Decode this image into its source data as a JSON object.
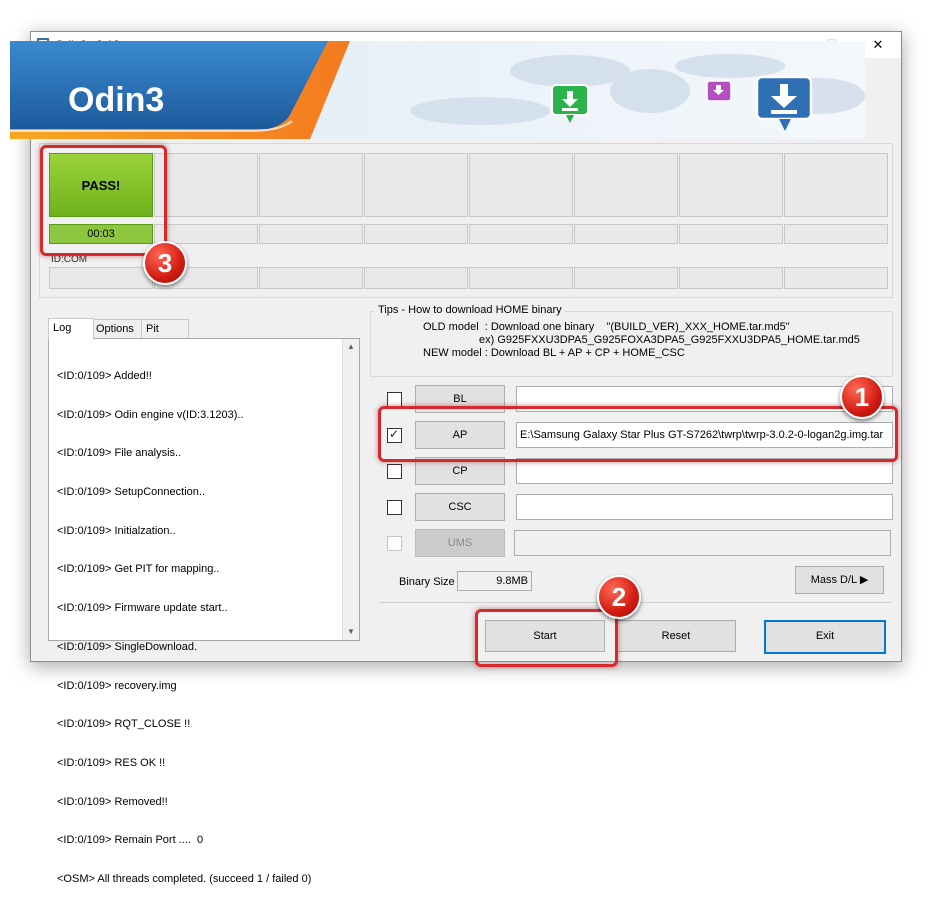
{
  "window": {
    "title": "Odin3 v3.12",
    "minimize_glyph": "—",
    "maximize_glyph": "☐",
    "close_glyph": "✕"
  },
  "banner": {
    "logo_text": "Odin3"
  },
  "ports": {
    "first_status": "PASS!",
    "first_time": "00:03",
    "id_com_label": "ID:COM"
  },
  "badges": {
    "one": "1",
    "two": "2",
    "three": "3"
  },
  "tabs": {
    "log": "Log",
    "options": "Options",
    "pit": "Pit"
  },
  "log": {
    "lines": [
      "<ID:0/109> Added!!",
      "<ID:0/109> Odin engine v(ID:3.1203)..",
      "<ID:0/109> File analysis..",
      "<ID:0/109> SetupConnection..",
      "<ID:0/109> Initialzation..",
      "<ID:0/109> Get PIT for mapping..",
      "<ID:0/109> Firmware update start..",
      "<ID:0/109> SingleDownload.",
      "<ID:0/109> recovery.img",
      "<ID:0/109> RQT_CLOSE !!",
      "<ID:0/109> RES OK !!",
      "<ID:0/109> Removed!!",
      "<ID:0/109> Remain Port ....  0",
      "<OSM> All threads completed. (succeed 1 / failed 0)"
    ]
  },
  "tips": {
    "title": "Tips - How to download HOME binary",
    "line1": "OLD model  : Download one binary    \"(BUILD_VER)_XXX_HOME.tar.md5\"",
    "line2": "ex) G925FXXU3DPA5_G925FOXA3DPA5_G925FXXU3DPA5_HOME.tar.md5",
    "line3": "NEW model : Download BL + AP + CP + HOME_CSC"
  },
  "files": {
    "bl": {
      "label": "BL",
      "checked": false,
      "path": ""
    },
    "ap": {
      "label": "AP",
      "checked": true,
      "check_glyph": "✓",
      "path": "E:\\Samsung Galaxy Star Plus GT-S7262\\twrp\\twrp-3.0.2-0-logan2g.img.tar"
    },
    "cp": {
      "label": "CP",
      "checked": false,
      "path": ""
    },
    "csc": {
      "label": "CSC",
      "checked": false,
      "path": ""
    },
    "ums": {
      "label": "UMS",
      "checked": false,
      "disabled": true,
      "path": ""
    }
  },
  "binary": {
    "label": "Binary Size",
    "value": "9.8MB"
  },
  "buttons": {
    "mass_dl": "Mass D/L ▶",
    "start": "Start",
    "reset": "Reset",
    "exit": "Exit"
  },
  "colors": {
    "pass_green": "#8dc63f",
    "badge_red": "#d21b12",
    "highlight_red": "#d9272e",
    "default_button_border": "#0078d7",
    "banner_orange": "#f7941d",
    "banner_blue": "#2b74b8"
  },
  "icons": {
    "app": "odin-app-icon",
    "download_green": "download-arrow-icon",
    "download_blue": "download-arrow-icon",
    "download_purple": "download-arrow-icon"
  }
}
